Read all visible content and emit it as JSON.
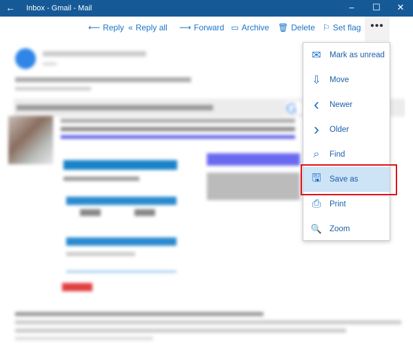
{
  "window": {
    "title": "Inbox - Gmail - Mail",
    "back_icon": "arrow-left-icon",
    "minimize": "–",
    "maximize": "☐",
    "close": "✕"
  },
  "toolbar": {
    "reply": "Reply",
    "reply_all": "Reply all",
    "forward": "Forward",
    "archive": "Archive",
    "delete": "Delete",
    "set_flag": "Set flag",
    "more": "•••"
  },
  "menu": {
    "items": [
      {
        "label": "Mark as unread",
        "icon": "envelope-icon",
        "glyph": "✉"
      },
      {
        "label": "Move",
        "icon": "move-to-folder-icon",
        "glyph": "⇩"
      },
      {
        "label": "Newer",
        "icon": "chevron-left-icon",
        "glyph": "‹"
      },
      {
        "label": "Older",
        "icon": "chevron-right-icon",
        "glyph": "›"
      },
      {
        "label": "Find",
        "icon": "search-icon",
        "glyph": "⌕"
      },
      {
        "label": "Save as",
        "icon": "save-icon",
        "glyph": "🖫"
      },
      {
        "label": "Print",
        "icon": "printer-icon",
        "glyph": "⎙"
      },
      {
        "label": "Zoom",
        "icon": "zoom-icon",
        "glyph": "🔍"
      }
    ],
    "selected": "Save as"
  },
  "colors": {
    "titlebar": "#155a96",
    "accent": "#1a73c9",
    "highlight": "#e0101a",
    "selected": "#cde3f6"
  }
}
